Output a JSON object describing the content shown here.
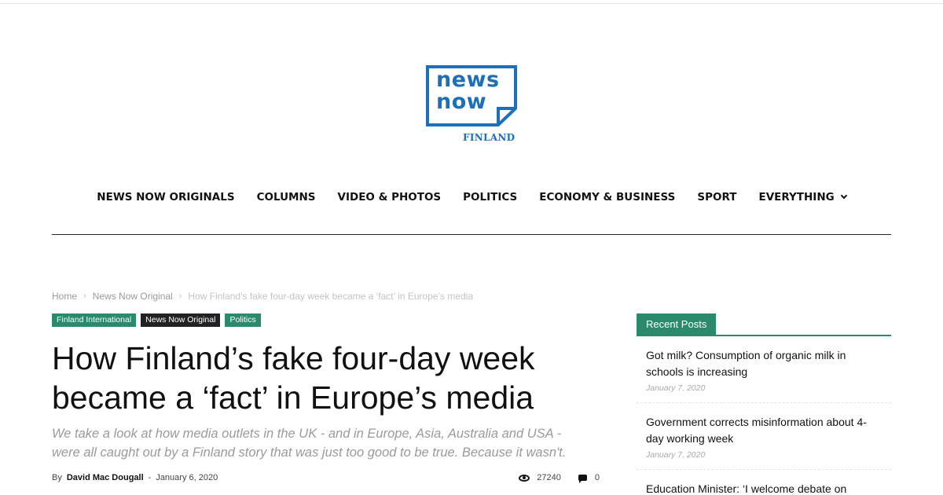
{
  "site": {
    "logo_main": "news\nnow",
    "logo_sub": "FINLAND"
  },
  "nav": {
    "items": [
      {
        "label": "NEWS NOW ORIGINALS"
      },
      {
        "label": "COLUMNS"
      },
      {
        "label": "VIDEO & PHOTOS"
      },
      {
        "label": "POLITICS"
      },
      {
        "label": "ECONOMY & BUSINESS"
      },
      {
        "label": "SPORT"
      },
      {
        "label": "EVERYTHING"
      }
    ]
  },
  "breadcrumb": {
    "home": "Home",
    "section": "News Now Original",
    "current": "How Finland’s fake four-day week became a ‘fact’ in Europe’s media",
    "separator": "›"
  },
  "tags": [
    {
      "label": "Finland International",
      "color": "#2a8a6b"
    },
    {
      "label": "News Now Original",
      "color": "#222222"
    },
    {
      "label": "Politics",
      "color": "#2a8a6b"
    }
  ],
  "article": {
    "title": "How Finland’s fake four-day week became a ‘fact’ in Europe’s media",
    "subtitle": "We take a look at how media outlets in the UK - and in Europe, Asia, Australia and USA - were all caught out by a Finland story that was just too good to be true. Because it wasn't.",
    "by_label": "By",
    "author": "David Mac Dougall",
    "dash": "-",
    "date": "January 6, 2020",
    "views": "27240",
    "comments": "0",
    "icons": {
      "views": "eye-icon",
      "comments": "comment-icon"
    }
  },
  "sidebar": {
    "heading": "Recent Posts",
    "accent": "#2a8a6b",
    "posts": [
      {
        "title": "Got milk? Consumption of organic milk in schools is increasing",
        "date": "January 7, 2020"
      },
      {
        "title": "Government corrects misinformation about 4-day working week",
        "date": "January 7, 2020"
      },
      {
        "title": "Education Minister: ‘I welcome debate on",
        "date": ""
      }
    ]
  },
  "colors": {
    "brand_blue": "#1d6fb8",
    "tag_green": "#2a8a6b",
    "tag_dark": "#222222"
  }
}
